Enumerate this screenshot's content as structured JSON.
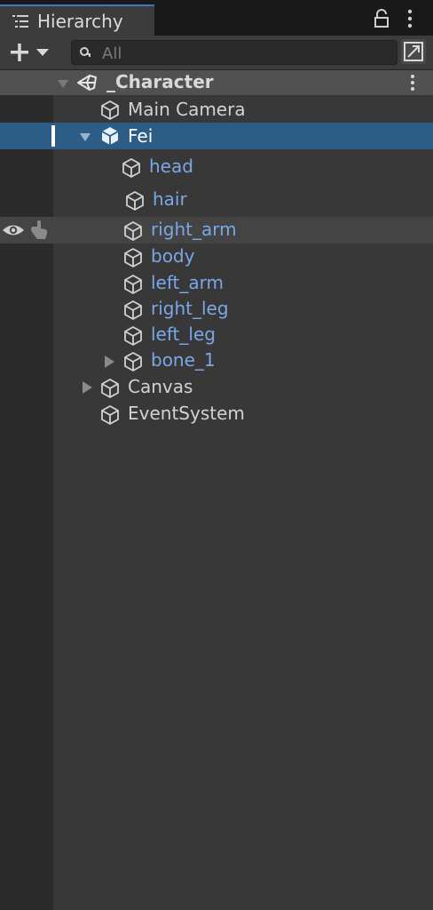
{
  "tab": {
    "title": "Hierarchy"
  },
  "search": {
    "placeholder": "All"
  },
  "hierarchy": {
    "scene": {
      "label": "_Character"
    },
    "items": [
      {
        "label": "Main Camera"
      },
      {
        "label": "Fei"
      },
      {
        "label": "head"
      },
      {
        "label": "hair"
      },
      {
        "label": "right_arm"
      },
      {
        "label": "body"
      },
      {
        "label": "left_arm"
      },
      {
        "label": "right_leg"
      },
      {
        "label": "left_leg"
      },
      {
        "label": "bone_1"
      },
      {
        "label": "Canvas"
      },
      {
        "label": "EventSystem"
      }
    ]
  },
  "colors": {
    "background": "#383838",
    "selection": "#2c5d87",
    "prefab_text": "#7ba7e6",
    "tab_accent": "#3a79bb"
  }
}
